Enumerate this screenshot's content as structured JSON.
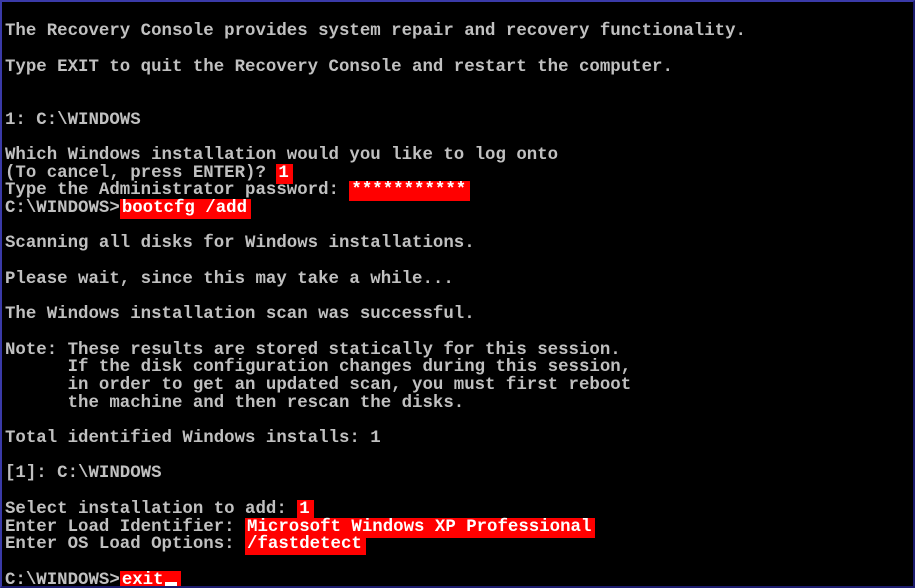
{
  "console": {
    "header_line1": "The Recovery Console provides system repair and recovery functionality.",
    "header_line2": "Type EXIT to quit the Recovery Console and restart the computer.",
    "install_list": "1: C:\\WINDOWS",
    "which_install": "Which Windows installation would you like to log onto",
    "cancel_prompt": "(To cancel, press ENTER)? ",
    "cancel_input": "1",
    "password_prompt": "Type the Administrator password: ",
    "password_input": "***********",
    "prompt1": "C:\\WINDOWS>",
    "command1": "bootcfg /add",
    "scanning": "Scanning all disks for Windows installations.",
    "please_wait": "Please wait, since this may take a while...",
    "scan_success": "The Windows installation scan was successful.",
    "note_line1": "Note: These results are stored statically for this session.",
    "note_line2": "      If the disk configuration changes during this session,",
    "note_line3": "      in order to get an updated scan, you must first reboot",
    "note_line4": "      the machine and then rescan the disks.",
    "total_installs": "Total identified Windows installs: 1",
    "found_install": "[1]: C:\\WINDOWS",
    "select_prompt": "Select installation to add: ",
    "select_input": "1",
    "load_id_prompt": "Enter Load Identifier: ",
    "load_id_input": "Microsoft Windows XP Professional",
    "os_options_prompt": "Enter OS Load Options: ",
    "os_options_input": "/fastdetect",
    "prompt2": "C:\\WINDOWS>",
    "command2": "exit"
  },
  "colors": {
    "background": "#000000",
    "text": "#c0c0c0",
    "highlight": "#ff0000",
    "highlight_text": "#ffffff"
  }
}
